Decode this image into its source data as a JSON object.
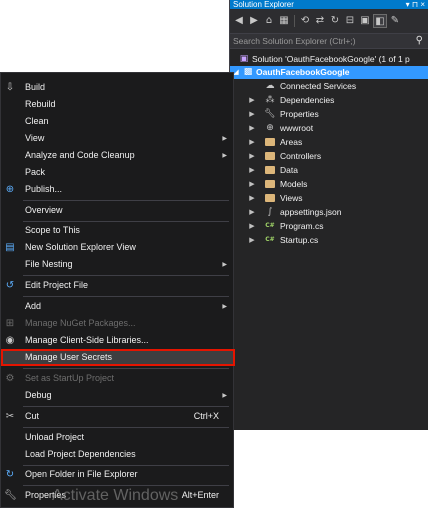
{
  "solution_explorer": {
    "title": "Solution Explorer",
    "title_buttons": "▾ ⊓ ×",
    "search_placeholder": "Search Solution Explorer (Ctrl+;)",
    "solution_label": "Solution 'OauthFacebookGoogle' (1 of 1 p",
    "project_label": "OauthFacebookGoogle",
    "items": [
      {
        "label": "Connected Services",
        "icon": "cloud-icon"
      },
      {
        "label": "Dependencies",
        "icon": "dependencies-icon"
      },
      {
        "label": "Properties",
        "icon": "wrench-icon"
      },
      {
        "label": "wwwroot",
        "icon": "globe-icon"
      },
      {
        "label": "Areas",
        "icon": "folder-icon"
      },
      {
        "label": "Controllers",
        "icon": "folder-icon"
      },
      {
        "label": "Data",
        "icon": "folder-icon"
      },
      {
        "label": "Models",
        "icon": "folder-icon"
      },
      {
        "label": "Views",
        "icon": "folder-icon"
      },
      {
        "label": "appsettings.json",
        "icon": "json-file-icon"
      },
      {
        "label": "Program.cs",
        "icon": "csharp-file-icon"
      },
      {
        "label": "Startup.cs",
        "icon": "csharp-file-icon"
      }
    ],
    "csharp_glyph": "C#"
  },
  "context_menu": {
    "items": [
      {
        "label": "Build",
        "shortcut": "",
        "submenu": false
      },
      {
        "label": "Rebuild",
        "shortcut": "",
        "submenu": false
      },
      {
        "label": "Clean",
        "shortcut": "",
        "submenu": false
      },
      {
        "label": "View",
        "shortcut": "",
        "submenu": true
      },
      {
        "label": "Analyze and Code Cleanup",
        "shortcut": "",
        "submenu": true
      },
      {
        "label": "Pack",
        "shortcut": "",
        "submenu": false
      },
      {
        "label": "Publish...",
        "shortcut": "",
        "submenu": false
      },
      {
        "label": "Overview",
        "shortcut": "",
        "submenu": false
      },
      {
        "label": "Scope to This",
        "shortcut": "",
        "submenu": false
      },
      {
        "label": "New Solution Explorer View",
        "shortcut": "",
        "submenu": false
      },
      {
        "label": "File Nesting",
        "shortcut": "",
        "submenu": true
      },
      {
        "label": "Edit Project File",
        "shortcut": "",
        "submenu": false
      },
      {
        "label": "Add",
        "shortcut": "",
        "submenu": true
      },
      {
        "label": "Manage NuGet Packages...",
        "shortcut": "",
        "submenu": false,
        "disabled": true
      },
      {
        "label": "Manage Client-Side Libraries...",
        "shortcut": "",
        "submenu": false
      },
      {
        "label": "Manage User Secrets",
        "shortcut": "",
        "submenu": false,
        "selected": true
      },
      {
        "label": "Set as StartUp Project",
        "shortcut": "",
        "submenu": false,
        "disabled": true
      },
      {
        "label": "Debug",
        "shortcut": "",
        "submenu": true
      },
      {
        "label": "Cut",
        "shortcut": "Ctrl+X",
        "submenu": false
      },
      {
        "label": "Unload Project",
        "shortcut": "",
        "submenu": false
      },
      {
        "label": "Load Project Dependencies",
        "shortcut": "",
        "submenu": false
      },
      {
        "label": "Open Folder in File Explorer",
        "shortcut": "",
        "submenu": false
      },
      {
        "label": "Properties",
        "shortcut": "Alt+Enter",
        "submenu": false
      }
    ],
    "submenu_arrow": "▶"
  },
  "watermark": "Activate Windows",
  "colors": {
    "accent": "#007acc",
    "selection": "#3399ff",
    "highlight_border": "#e51400",
    "menu_bg": "#1b1b1c",
    "panel_bg": "#252526"
  }
}
